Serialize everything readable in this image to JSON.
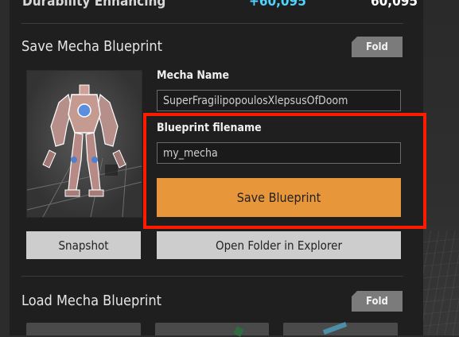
{
  "top_row": {
    "label": "Durability Enhancing",
    "bonus": "+60,095",
    "value": "60,095"
  },
  "save_section": {
    "title": "Save Mecha Blueprint",
    "fold_label": "Fold",
    "mecha_name_label": "Mecha Name",
    "mecha_name_value": "SuperFragilipopoulosXlepsusOfDoom",
    "blueprint_filename_label": "Blueprint filename",
    "blueprint_filename_value": "my_mecha",
    "save_button_label": "Save Blueprint",
    "snapshot_button_label": "Snapshot",
    "open_folder_button_label": "Open Folder in Explorer"
  },
  "load_section": {
    "title": "Load Mecha Blueprint",
    "fold_label": "Fold"
  },
  "colors": {
    "panel_bg": "#1f1f1f",
    "accent_orange": "#e8963a",
    "bonus_cyan": "#4fd4ff",
    "highlight_red": "#ff1a00",
    "fold_gray": "#7b7b7b"
  }
}
